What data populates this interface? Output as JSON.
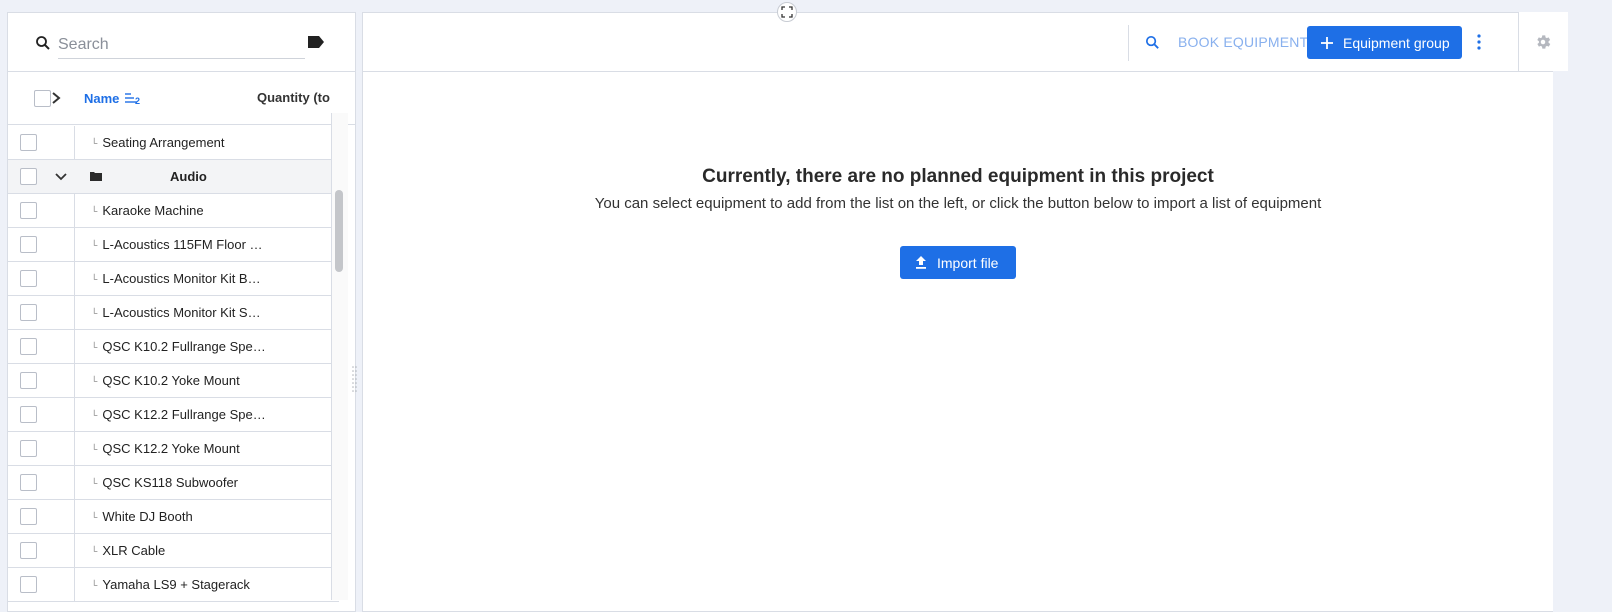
{
  "search": {
    "placeholder": "Search"
  },
  "grid": {
    "columns": {
      "name": "Name",
      "sort_order": "2",
      "quantity": "Quantity (to"
    },
    "rows": [
      {
        "label": "Seating Arrangement",
        "type": "item"
      },
      {
        "label": "Audio",
        "type": "group"
      },
      {
        "label": "Karaoke Machine",
        "type": "item"
      },
      {
        "label": "L-Acoustics 115FM Floor …",
        "type": "item"
      },
      {
        "label": "L-Acoustics Monitor Kit B…",
        "type": "item"
      },
      {
        "label": "L-Acoustics Monitor Kit S…",
        "type": "item"
      },
      {
        "label": "QSC K10.2 Fullrange Spe…",
        "type": "item"
      },
      {
        "label": "QSC K10.2 Yoke Mount",
        "type": "item"
      },
      {
        "label": "QSC K12.2 Fullrange Spe…",
        "type": "item"
      },
      {
        "label": "QSC K12.2 Yoke Mount",
        "type": "item"
      },
      {
        "label": "QSC KS118 Subwoofer",
        "type": "item"
      },
      {
        "label": "White DJ Booth",
        "type": "item"
      },
      {
        "label": "XLR Cable",
        "type": "item"
      },
      {
        "label": "Yamaha LS9 + Stagerack",
        "type": "item"
      }
    ]
  },
  "toolbar": {
    "book_label": "BOOK EQUIPMENT",
    "group_label": "Equipment group"
  },
  "empty_state": {
    "title": "Currently, there are no planned equipment in this project",
    "subtitle": "You can select equipment to add from the list on the left, or click the button below to import a list of equipment",
    "import_label": "Import file"
  },
  "colors": {
    "accent": "#1e6fe6",
    "accent_light": "#88b0ee",
    "background": "#eef1f8"
  }
}
